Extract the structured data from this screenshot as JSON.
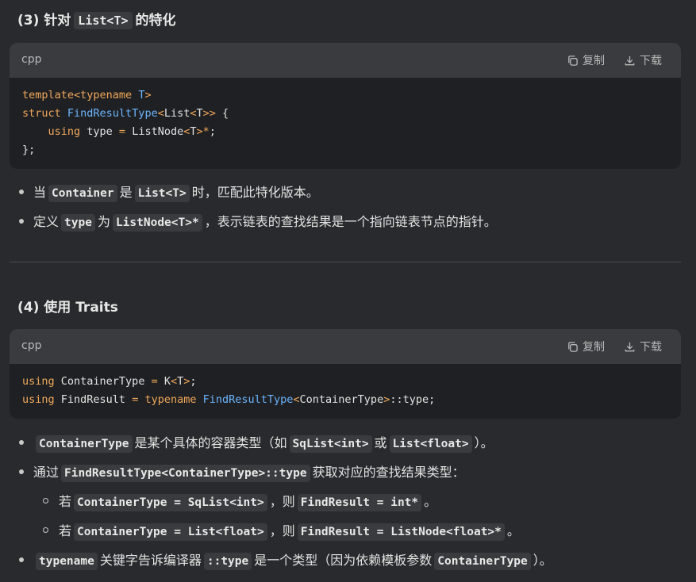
{
  "section3": {
    "title_prefix": "(3) 针对",
    "title_code": "List<T>",
    "title_suffix": "的特化",
    "code": {
      "lang": "cpp",
      "copy_label": "复制",
      "download_label": "下载",
      "lines": [
        [
          {
            "t": "template<typename ",
            "c": "kw"
          },
          {
            "t": "T",
            "c": "ty"
          },
          {
            "t": ">",
            "c": "kw"
          }
        ],
        [
          {
            "t": "struct ",
            "c": "kw"
          },
          {
            "t": "FindResultType",
            "c": "ty"
          },
          {
            "t": "<",
            "c": "kw"
          },
          {
            "t": "List",
            "c": "pl"
          },
          {
            "t": "<",
            "c": "kw"
          },
          {
            "t": "T",
            "c": "pl"
          },
          {
            "t": ">>",
            "c": "kw"
          },
          {
            "t": " {",
            "c": "pl"
          }
        ],
        [
          {
            "t": "    using ",
            "c": "kw"
          },
          {
            "t": "type ",
            "c": "pl"
          },
          {
            "t": "= ",
            "c": "kw"
          },
          {
            "t": "ListNode",
            "c": "pl"
          },
          {
            "t": "<",
            "c": "kw"
          },
          {
            "t": "T",
            "c": "pl"
          },
          {
            "t": ">*",
            "c": "kw"
          },
          {
            "t": ";",
            "c": "pl"
          }
        ],
        [
          {
            "t": "};",
            "c": "pl"
          }
        ]
      ]
    },
    "bullets": [
      [
        {
          "t": "当"
        },
        {
          "t": "Container",
          "code": true
        },
        {
          "t": "是"
        },
        {
          "t": "List<T>",
          "code": true
        },
        {
          "t": "时，匹配此特化版本。"
        }
      ],
      [
        {
          "t": "定义"
        },
        {
          "t": "type",
          "code": true
        },
        {
          "t": "为"
        },
        {
          "t": "ListNode<T>*",
          "code": true
        },
        {
          "t": "，表示链表的查找结果是一个指向链表节点的指针。"
        }
      ]
    ]
  },
  "section4": {
    "title": "(4) 使用 Traits",
    "code": {
      "lang": "cpp",
      "copy_label": "复制",
      "download_label": "下载",
      "lines": [
        [
          {
            "t": "using ",
            "c": "kw"
          },
          {
            "t": "ContainerType ",
            "c": "pl"
          },
          {
            "t": "= ",
            "c": "kw"
          },
          {
            "t": "K",
            "c": "pl"
          },
          {
            "t": "<",
            "c": "kw"
          },
          {
            "t": "T",
            "c": "pl"
          },
          {
            "t": ">",
            "c": "kw"
          },
          {
            "t": ";",
            "c": "pl"
          }
        ],
        [
          {
            "t": "using ",
            "c": "kw"
          },
          {
            "t": "FindResult ",
            "c": "pl"
          },
          {
            "t": "= typename ",
            "c": "kw"
          },
          {
            "t": "FindResultType",
            "c": "ty"
          },
          {
            "t": "<",
            "c": "kw"
          },
          {
            "t": "ContainerType",
            "c": "pl"
          },
          {
            "t": ">",
            "c": "kw"
          },
          {
            "t": "::type;",
            "c": "pl"
          }
        ]
      ]
    },
    "bullets": [
      {
        "level": 1,
        "parts": [
          {
            "t": "ContainerType",
            "code": true
          },
          {
            "t": "是某个具体的容器类型（如"
          },
          {
            "t": "SqList<int>",
            "code": true
          },
          {
            "t": "或"
          },
          {
            "t": "List<float>",
            "code": true
          },
          {
            "t": "）。"
          }
        ]
      },
      {
        "level": 1,
        "parts": [
          {
            "t": "通过"
          },
          {
            "t": "FindResultType<ContainerType>::type",
            "code": true
          },
          {
            "t": "获取对应的查找结果类型："
          }
        ]
      },
      {
        "level": 2,
        "parts": [
          {
            "t": "若"
          },
          {
            "t": "ContainerType = SqList<int>",
            "code": true
          },
          {
            "t": "，则"
          },
          {
            "t": "FindResult = int*",
            "code": true
          },
          {
            "t": "。"
          }
        ]
      },
      {
        "level": 2,
        "parts": [
          {
            "t": "若"
          },
          {
            "t": "ContainerType = List<float>",
            "code": true
          },
          {
            "t": "，则"
          },
          {
            "t": "FindResult = ListNode<float>*",
            "code": true
          },
          {
            "t": "。"
          }
        ]
      },
      {
        "level": 1,
        "parts": [
          {
            "t": "typename",
            "code": true
          },
          {
            "t": "关键字告诉编译器"
          },
          {
            "t": "::type",
            "code": true
          },
          {
            "t": "是一个类型（因为依赖模板参数"
          },
          {
            "t": "ContainerType",
            "code": true
          },
          {
            "t": "）。"
          }
        ]
      }
    ]
  }
}
